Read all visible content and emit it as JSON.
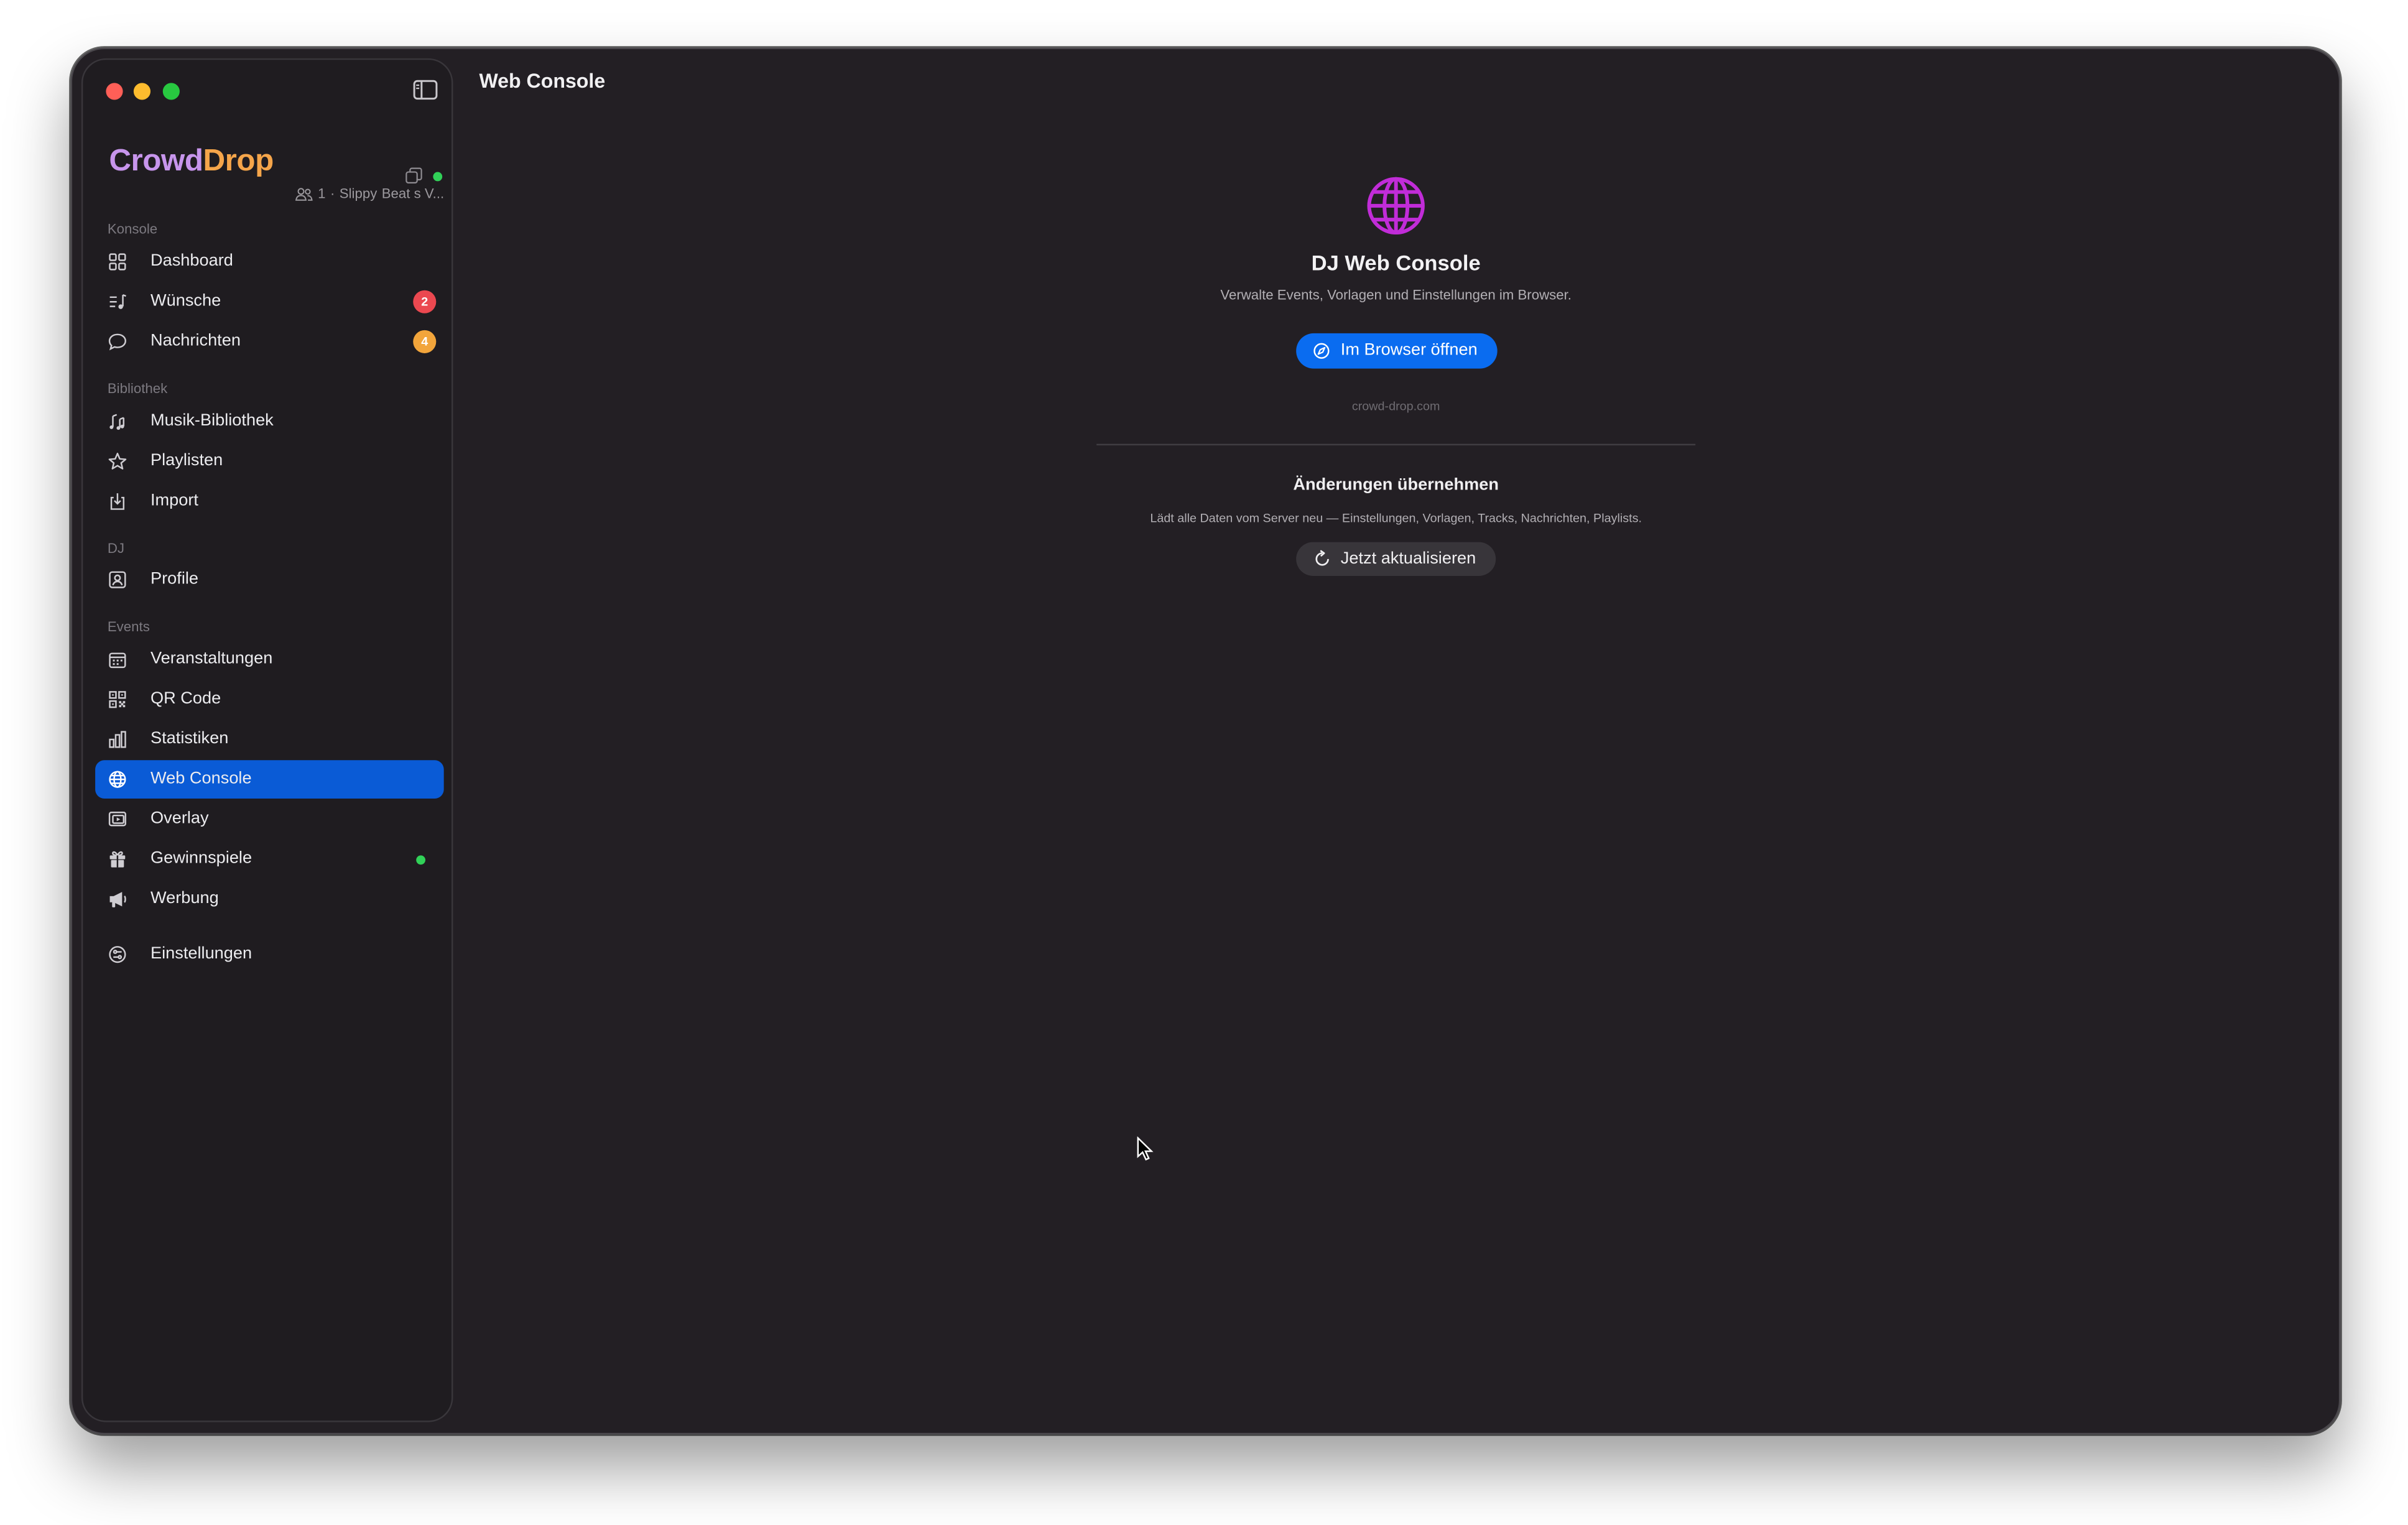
{
  "window": {
    "title": "Web Console"
  },
  "sidebar": {
    "brand": {
      "part1": "Crowd",
      "part2": "Drop"
    },
    "session": {
      "count": "1",
      "sep": "·",
      "name": "Slippy",
      "event": "Beat s V..."
    },
    "sections": {
      "konsole": "Konsole",
      "bibliothek": "Bibliothek",
      "dj": "DJ",
      "events": "Events"
    },
    "items": {
      "dashboard": {
        "label": "Dashboard",
        "icon": "grid-icon"
      },
      "wuensche": {
        "label": "Wünsche",
        "icon": "music-list-icon",
        "badge": "2"
      },
      "nachrichten": {
        "label": "Nachrichten",
        "icon": "chat-bubble-icon",
        "badge": "4"
      },
      "musik": {
        "label": "Musik-Bibliothek",
        "icon": "music-notes-icon"
      },
      "playlisten": {
        "label": "Playlisten",
        "icon": "star-icon"
      },
      "import": {
        "label": "Import",
        "icon": "import-icon"
      },
      "profile": {
        "label": "Profile",
        "icon": "profile-card-icon"
      },
      "veranstaltungen": {
        "label": "Veranstaltungen",
        "icon": "calendar-icon"
      },
      "qrcode": {
        "label": "QR Code",
        "icon": "qr-code-icon"
      },
      "statistiken": {
        "label": "Statistiken",
        "icon": "bar-chart-icon"
      },
      "webconsole": {
        "label": "Web Console",
        "icon": "globe-icon"
      },
      "overlay": {
        "label": "Overlay",
        "icon": "overlay-icon"
      },
      "gewinnspiele": {
        "label": "Gewinnspiele",
        "icon": "gift-icon"
      },
      "werbung": {
        "label": "Werbung",
        "icon": "megaphone-icon"
      },
      "einstellungen": {
        "label": "Einstellungen",
        "icon": "settings-icon"
      }
    }
  },
  "main": {
    "title": "Web Console",
    "heading": "DJ Web Console",
    "subtitle": "Verwalte Events, Vorlagen und Einstellungen im Browser.",
    "open_button": "Im Browser öffnen",
    "url": "crowd-drop.com",
    "apply_heading": "Änderungen übernehmen",
    "apply_subtitle": "Lädt alle Daten vom Server neu — Einstellungen, Vorlagen, Tracks, Nachrichten, Playlists.",
    "refresh_button": "Jetzt aktualisieren"
  },
  "colors": {
    "accent": "#0a6cf0",
    "active_item": "#0a5bd6",
    "globe": "#c12cd8",
    "brand_crowd": "#c795ec",
    "brand_drop": "#f5a54a",
    "badge_red": "#eb4850",
    "badge_orange": "#f2a53b",
    "online": "#31d158"
  }
}
